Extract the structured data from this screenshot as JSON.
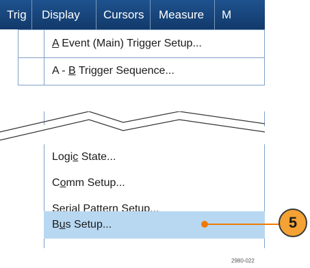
{
  "menubar": {
    "items": [
      "Trig",
      "Display",
      "Cursors",
      "Measure",
      "M"
    ]
  },
  "dropdown": {
    "items": [
      {
        "pre": "",
        "accel": "A",
        "post": " Event (Main) Trigger Setup..."
      },
      {
        "pre": "A - ",
        "accel": "B",
        "post": " Trigger Sequence..."
      },
      {
        "pre": "Logi",
        "accel": "c",
        "post": " State..."
      },
      {
        "pre": "C",
        "accel": "o",
        "post": "mm Setup..."
      },
      {
        "pre": "Serial ",
        "accel": "P",
        "post": "attern Setup..."
      },
      {
        "pre": "B",
        "accel": "u",
        "post": "s Setup..."
      }
    ],
    "selected_item": "Bus Setup..."
  },
  "callout": {
    "number": "5"
  },
  "figure_id": "2980-022",
  "colors": {
    "menubar": "#16447a",
    "selection": "#b8d8f2",
    "callout": "#f3a233",
    "callout_line": "#f07a00"
  }
}
